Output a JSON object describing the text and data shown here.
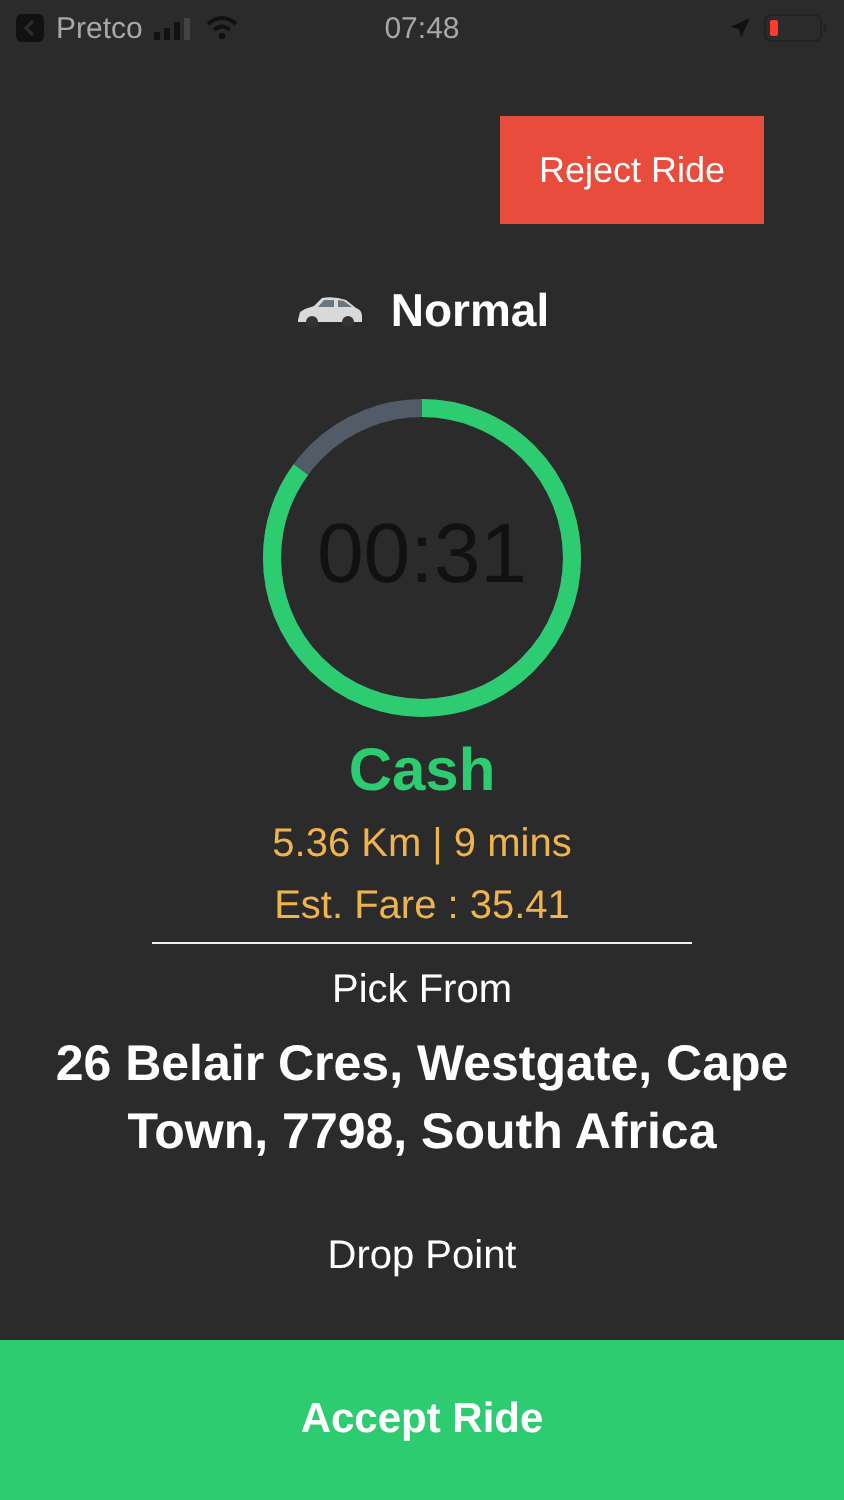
{
  "status_bar": {
    "carrier": "Pretco",
    "time": "07:48"
  },
  "reject_button": "Reject Ride",
  "vehicle": {
    "name": "Normal"
  },
  "timer": {
    "time": "00:31",
    "level": 0.85
  },
  "payment": "Cash",
  "trip": {
    "distance": "5.36 Km | 9 mins",
    "fare": "Est. Fare : 35.41"
  },
  "pickup": {
    "label": "Pick From",
    "address": "26 Belair Cres, Westgate, Cape Town, 7798, South Africa"
  },
  "dropoff": {
    "label": "Drop Point"
  },
  "accept_button": "Accept Ride"
}
